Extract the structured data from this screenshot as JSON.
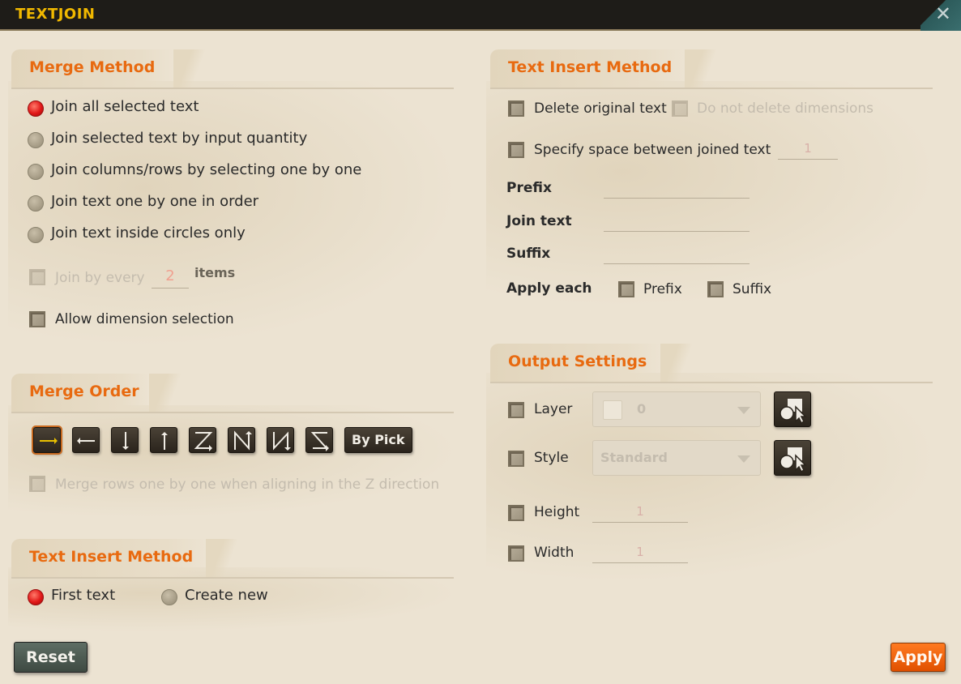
{
  "window": {
    "title": "TEXTJOIN",
    "close_icon": "close-icon"
  },
  "merge_method": {
    "heading": "Merge Method",
    "options": [
      "Join all selected text",
      "Join selected text by input quantity",
      "Join columns/rows by selecting one by one",
      "Join text one by one in order",
      "Join text inside circles only"
    ],
    "selected_index": 0,
    "join_by_every_label": "Join by every",
    "join_by_every_value": "2",
    "items_label": "items",
    "allow_dimension_label": "Allow dimension selection"
  },
  "merge_order": {
    "heading": "Merge Order",
    "buttons": [
      "right-arrow-icon",
      "left-arrow-icon",
      "down-arrow-icon",
      "up-arrow-icon",
      "z-pattern-icon",
      "n-pattern-icon",
      "reverse-n-pattern-icon",
      "reverse-z-pattern-icon"
    ],
    "by_pick_label": "By Pick",
    "merge_rows_label": "Merge rows one by one when aligning in the Z direction"
  },
  "text_insert_left": {
    "heading": "Text Insert Method",
    "options": [
      "First text",
      "Create new"
    ],
    "selected_index": 0
  },
  "text_insert_right": {
    "heading": "Text Insert Method",
    "delete_original_label": "Delete original text",
    "do_not_delete_dims_label": "Do not delete dimensions",
    "specify_space_label": "Specify space between joined text",
    "specify_space_value": "1",
    "prefix_label": "Prefix",
    "join_text_label": "Join text",
    "suffix_label": "Suffix",
    "apply_each_label": "Apply each",
    "apply_prefix_label": "Prefix",
    "apply_suffix_label": "Suffix"
  },
  "output_settings": {
    "heading": "Output Settings",
    "layer_label": "Layer",
    "layer_value": "0",
    "style_label": "Style",
    "style_value": "Standard",
    "height_label": "Height",
    "height_value": "1",
    "width_label": "Width",
    "width_value": "1"
  },
  "footer": {
    "reset_label": "Reset",
    "apply_label": "Apply"
  },
  "colors": {
    "accent": "#e86a10",
    "title": "#f0b800",
    "apply_bg": "#ff6a10",
    "reset_bg": "#4e5c52"
  }
}
